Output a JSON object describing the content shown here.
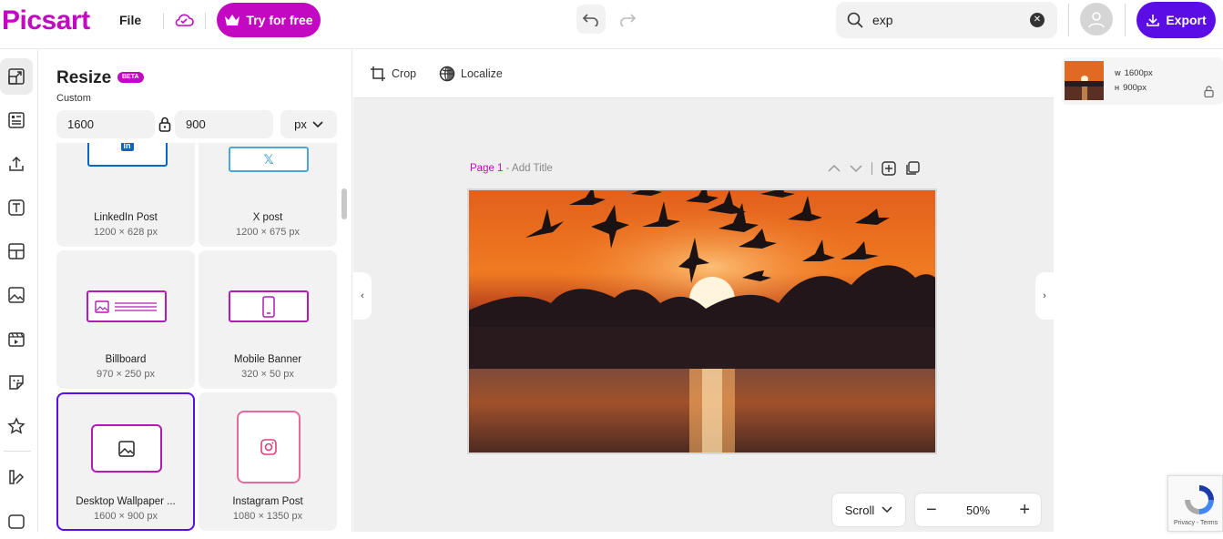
{
  "app": {
    "logo": "Picsart",
    "file_label": "File",
    "try_label": "Try for free",
    "export_label": "Export",
    "accent_color": "#c209c1",
    "export_color": "#5a0ee5"
  },
  "search": {
    "value": "exp"
  },
  "rail": {
    "items": [
      "resize",
      "templates",
      "upload",
      "text",
      "layout",
      "photos",
      "video",
      "stickers",
      "favorites",
      "brand-kit",
      "folders"
    ]
  },
  "resize_panel": {
    "title": "Resize",
    "badge": "BETA",
    "custom_label": "Custom",
    "width_value": "1600",
    "height_value": "900",
    "unit": "px",
    "presets": [
      {
        "name": "LinkedIn Post",
        "size": "1200 × 628 px",
        "icon": "linkedin-icon"
      },
      {
        "name": "X post",
        "size": "1200 × 675 px",
        "icon": "x-icon"
      },
      {
        "name": "Billboard",
        "size": "970 × 250 px",
        "icon": "billboard-icon"
      },
      {
        "name": "Mobile Banner",
        "size": "320 × 50 px",
        "icon": "phone-icon"
      },
      {
        "name": "Desktop Wallpaper ...",
        "size": "1600 × 900 px",
        "icon": "image-icon"
      },
      {
        "name": "Instagram Post",
        "size": "1080 × 1350 px",
        "icon": "instagram-icon"
      }
    ]
  },
  "canvas_toolbar": {
    "crop_label": "Crop",
    "localize_label": "Localize"
  },
  "page": {
    "page_label": "Page 1",
    "separator": " - ",
    "add_title": "Add Title"
  },
  "view": {
    "scroll_label": "Scroll",
    "zoom_value": "50%"
  },
  "layer": {
    "w_label": "W",
    "w_value": "1600px",
    "h_label": "H",
    "h_value": "900px"
  },
  "recaptcha": {
    "links": "Privacy - Terms"
  }
}
